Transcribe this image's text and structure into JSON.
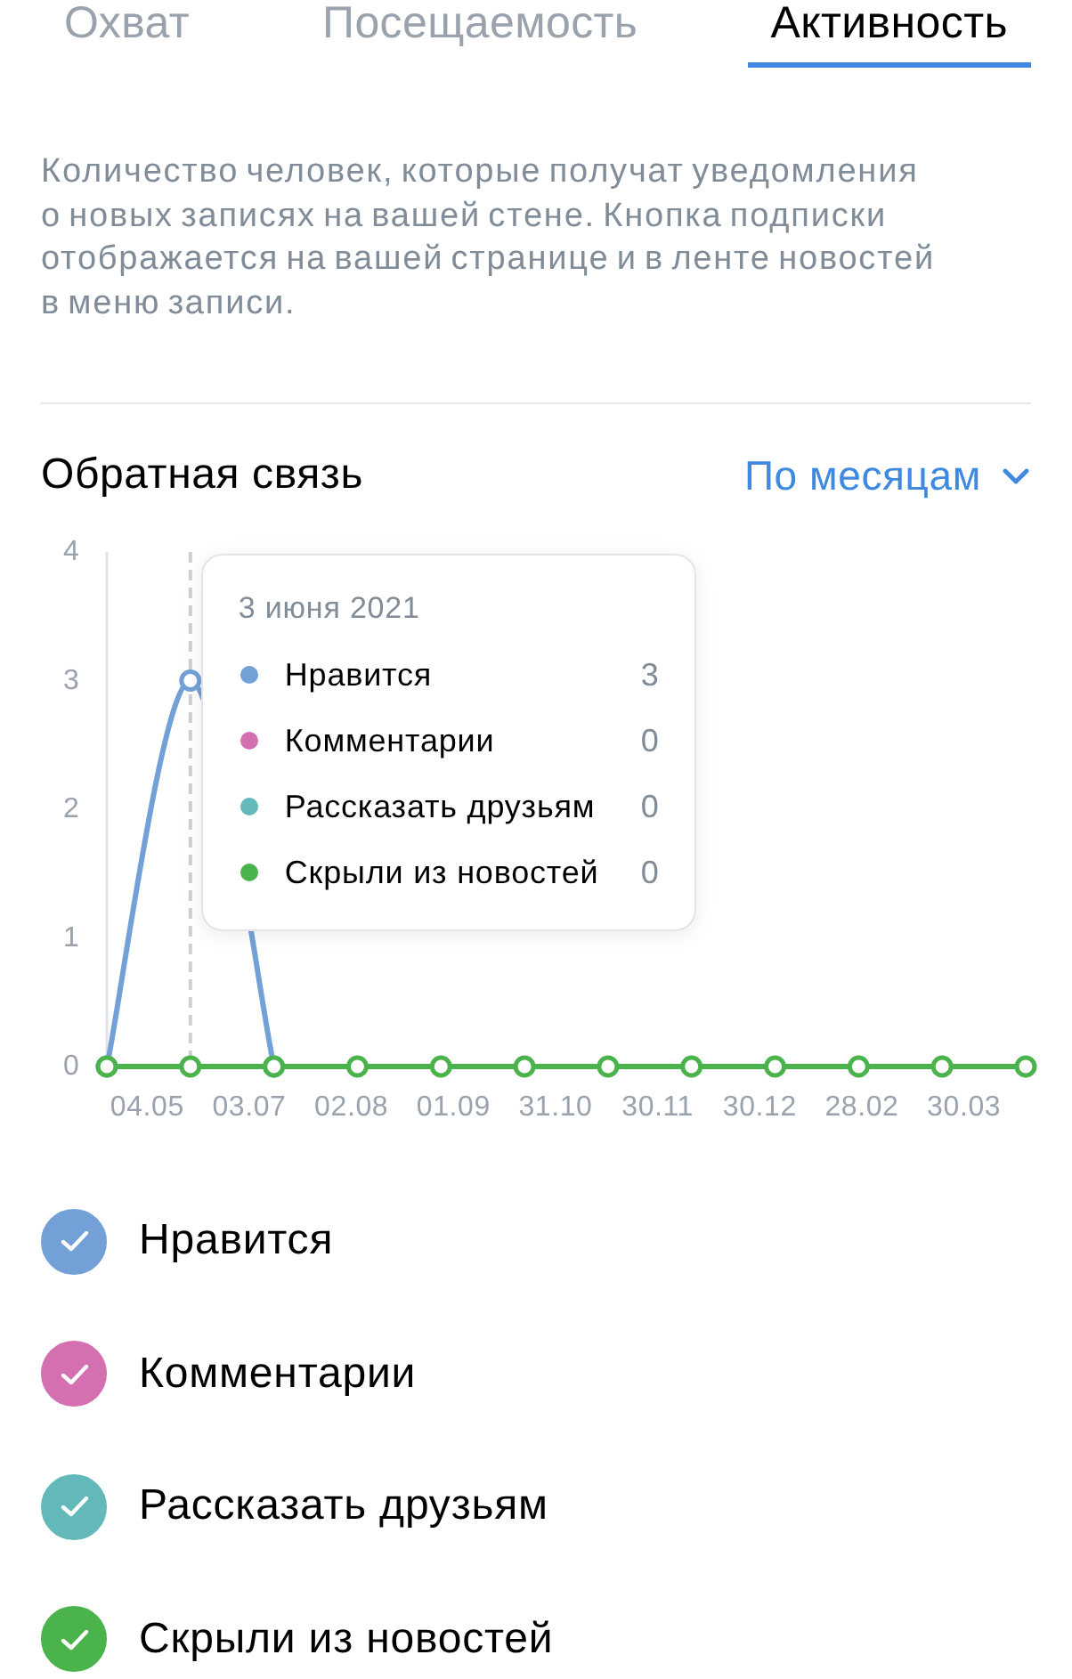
{
  "tabs": [
    {
      "label": "Охват",
      "selected": false
    },
    {
      "label": "Посещаемость",
      "selected": false
    },
    {
      "label": "Активность",
      "selected": true
    }
  ],
  "description": "Количество человек, которые получат уведомления о новых записях на вашей стене. Кнопка подписки отображается на вашей странице и в ленте новостей в меню записи.",
  "feedback": {
    "title": "Обратная связь",
    "period": "По месяцам",
    "chart_data": {
      "type": "line",
      "ylim": [
        0,
        4
      ],
      "yticks": [
        {
          "value": 0,
          "label": "0"
        },
        {
          "value": 1,
          "label": "1"
        },
        {
          "value": 2,
          "label": "2"
        },
        {
          "value": 3,
          "label": "3"
        },
        {
          "value": 4,
          "label": "4"
        }
      ],
      "series": [
        {
          "name": "Нравится",
          "color": "#73a1d7",
          "marker": "circle",
          "values": [
            0,
            3,
            0,
            null,
            null,
            null,
            null,
            null,
            null,
            null,
            null,
            null
          ]
        },
        {
          "name": "Комментарии",
          "color": "#d470b0",
          "values": [
            null,
            null,
            null,
            null,
            null,
            null,
            null,
            null,
            null,
            null,
            null,
            null
          ]
        },
        {
          "name": "Рассказать друзьям",
          "color": "#63b8ba",
          "values": [
            null,
            null,
            null,
            null,
            null,
            null,
            null,
            null,
            null,
            null,
            null,
            null
          ]
        },
        {
          "name": "Скрыли из новостей",
          "color": "#4bb34b",
          "marker": "circle",
          "values": [
            0,
            0,
            0,
            0,
            0,
            0,
            0,
            0,
            0,
            0,
            0,
            0
          ]
        }
      ],
      "legend": true
    },
    "x_labels": [
      "04.05",
      "03.07",
      "02.08",
      "01.09",
      "31.10",
      "30.11",
      "30.12",
      "28.02",
      "30.03"
    ],
    "hover": [
      {
        "selected": false
      },
      {
        "selected": true
      },
      {
        "selected": false
      },
      {
        "selected": false
      },
      {
        "selected": false
      },
      {
        "selected": false
      },
      {
        "selected": false
      },
      {
        "selected": false
      },
      {
        "selected": false
      },
      {
        "selected": false
      },
      {
        "selected": false
      },
      {
        "selected": false
      }
    ],
    "tooltip": {
      "title": "3 июня 2021",
      "rows": [
        {
          "label": "Нравится",
          "value": "3",
          "color": "#73a1d7"
        },
        {
          "label": "Комментарии",
          "value": "0",
          "color": "#d470b0"
        },
        {
          "label": "Рассказать друзьям",
          "value": "0",
          "color": "#63b8ba"
        },
        {
          "label": "Скрыли из новостей",
          "value": "0",
          "color": "#4bb34b"
        }
      ]
    },
    "series_toggles": [
      {
        "checked": true
      },
      {
        "checked": true
      },
      {
        "checked": true
      },
      {
        "checked": true
      }
    ]
  }
}
